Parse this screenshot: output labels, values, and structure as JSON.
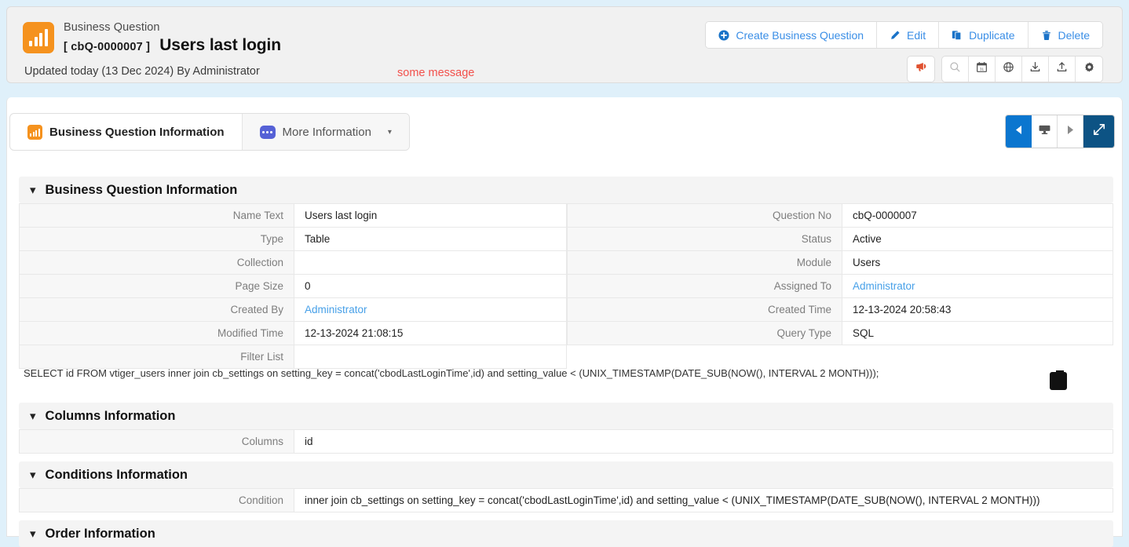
{
  "header": {
    "module_label": "Business Question",
    "record_no": "[ cbQ-0000007 ]",
    "record_name": "Users last login",
    "updated_text": "Updated today (13 Dec 2024) By Administrator",
    "message": "some message",
    "brand_color": "#f5921e",
    "link_color": "#3a8ee6",
    "message_color": "#f2504b"
  },
  "actions": [
    {
      "label": "Create Business Question",
      "icon": "plus-circle-icon"
    },
    {
      "label": "Edit",
      "icon": "pencil-icon"
    },
    {
      "label": "Duplicate",
      "icon": "duplicate-icon"
    },
    {
      "label": "Delete",
      "icon": "trash-icon"
    }
  ],
  "tools": {
    "highlighted": {
      "icon": "megaphone-icon",
      "color": "#e0512f"
    },
    "group": [
      {
        "icon": "search-icon"
      },
      {
        "icon": "calendar-icon",
        "day": "31"
      },
      {
        "icon": "globe-icon"
      },
      {
        "icon": "download-icon"
      },
      {
        "icon": "upload-icon"
      },
      {
        "icon": "gear-icon"
      }
    ]
  },
  "tabs": [
    {
      "label": "Business Question Information",
      "icon": "chart-icon",
      "active": true
    },
    {
      "label": "More Information",
      "icon": "dots-icon",
      "active": false,
      "caret": "▾"
    }
  ],
  "nav": [
    {
      "icon": "prev-arrow-icon",
      "style": "blue"
    },
    {
      "icon": "screen-icon",
      "style": "white"
    },
    {
      "icon": "next-arrow-icon",
      "style": "white"
    },
    {
      "icon": "expand-icon",
      "style": "darkblue"
    }
  ],
  "sections": {
    "business_question": {
      "title": "Business Question Information",
      "left_rows": [
        {
          "label": "Name Text",
          "value": "Users last login",
          "link": false
        },
        {
          "label": "Type",
          "value": "Table",
          "link": false
        },
        {
          "label": "Collection",
          "value": "",
          "link": false
        },
        {
          "label": "Page Size",
          "value": "0",
          "link": false
        },
        {
          "label": "Created By",
          "value": "Administrator",
          "link": true
        },
        {
          "label": "Modified Time",
          "value": "12-13-2024 21:08:15",
          "link": false
        },
        {
          "label": "Filter List",
          "value": "",
          "link": false
        }
      ],
      "right_rows": [
        {
          "label": "Question No",
          "value": "cbQ-0000007",
          "link": false
        },
        {
          "label": "Status",
          "value": "Active",
          "link": false
        },
        {
          "label": "Module",
          "value": "Users",
          "link": false
        },
        {
          "label": "Assigned To",
          "value": "Administrator",
          "link": true
        },
        {
          "label": "Created Time",
          "value": "12-13-2024 20:58:43",
          "link": false
        },
        {
          "label": "Query Type",
          "value": "SQL",
          "link": false
        }
      ]
    },
    "sql_statement": "SELECT id FROM vtiger_users inner join cb_settings on setting_key = concat('cbodLastLoginTime',id) and setting_value < (UNIX_TIMESTAMP(DATE_SUB(NOW(), INTERVAL 2 MONTH)));",
    "copy_icon": "clipboard-icon",
    "columns": {
      "title": "Columns Information",
      "rows": [
        {
          "label": "Columns",
          "value": "id"
        }
      ]
    },
    "conditions": {
      "title": "Conditions Information",
      "rows": [
        {
          "label": "Condition",
          "value": "inner join cb_settings on setting_key = concat('cbodLastLoginTime',id) and setting_value < (UNIX_TIMESTAMP(DATE_SUB(NOW(), INTERVAL 2 MONTH)))"
        }
      ]
    },
    "order": {
      "title": "Order Information"
    }
  }
}
